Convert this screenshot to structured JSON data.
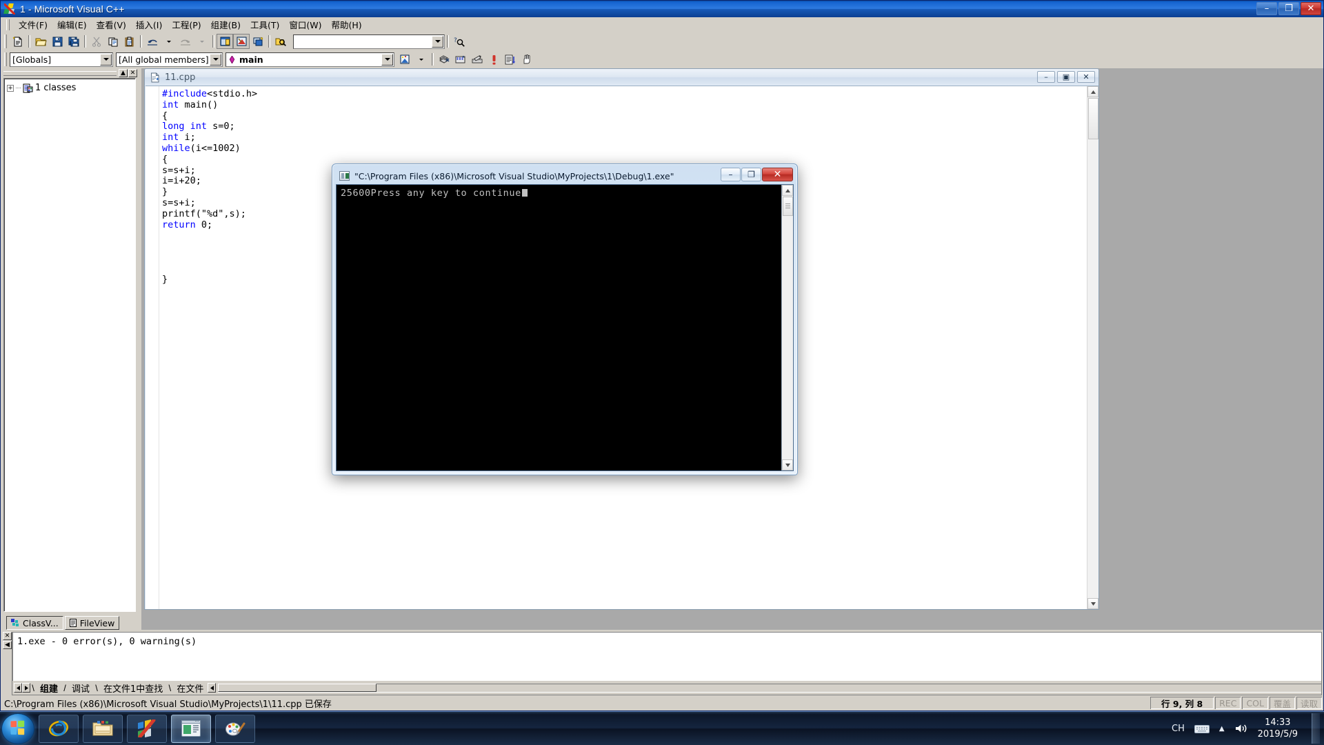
{
  "window": {
    "title": "1 - Microsoft Visual C++",
    "icon": "vc-logo-icon",
    "minimize": "–",
    "maximize": "❐",
    "close": "✕"
  },
  "menu": {
    "items": [
      {
        "label": "文件(F)",
        "name": "menu-file"
      },
      {
        "label": "编辑(E)",
        "name": "menu-edit"
      },
      {
        "label": "查看(V)",
        "name": "menu-view"
      },
      {
        "label": "插入(I)",
        "name": "menu-insert"
      },
      {
        "label": "工程(P)",
        "name": "menu-project"
      },
      {
        "label": "组建(B)",
        "name": "menu-build"
      },
      {
        "label": "工具(T)",
        "name": "menu-tools"
      },
      {
        "label": "窗口(W)",
        "name": "menu-window"
      },
      {
        "label": "帮助(H)",
        "name": "menu-help"
      }
    ]
  },
  "toolbar": {
    "search_box_value": "",
    "buttons": [
      "new-text-file-icon",
      "open-folder-icon",
      "save-icon",
      "save-all-icon",
      "cut-icon",
      "copy-icon",
      "paste-icon",
      "undo-icon",
      "redo-icon",
      "workspace-icon",
      "output-icon",
      "window-list-icon",
      "find-in-files-icon",
      "find-help-icon"
    ]
  },
  "wizardbar": {
    "scope_value": "[Globals]",
    "members_value": "[All global members]",
    "function_value": "main",
    "buttons": [
      "compile-icon",
      "build-icon",
      "rebuild-all-icon",
      "stop-build-icon",
      "batch-build-icon",
      "execute-program-icon"
    ]
  },
  "workspace": {
    "tree_root_label": "1 classes",
    "tree_root_icon": "classes-folder-icon",
    "expander": "+",
    "tabs": [
      {
        "label": "ClassV...",
        "name": "workspace-tab-classview",
        "icon": "classview-icon",
        "selected": true
      },
      {
        "label": "FileView",
        "name": "workspace-tab-fileview",
        "icon": "fileview-icon",
        "selected": false
      }
    ],
    "close_glyph": "✕",
    "collapse_glyph": "▲"
  },
  "editor": {
    "document_name": "11.cpp",
    "document_icon": "source-file-icon",
    "minimize": "–",
    "maximize": "▣",
    "close": "✕",
    "code_lines": [
      {
        "text": "#include<stdio.h>",
        "kw": "#include"
      },
      {
        "text": "int main()",
        "kw": "int"
      },
      {
        "text": "{",
        "kw": ""
      },
      {
        "text": "long int s=0;",
        "kw": "long int"
      },
      {
        "text": "int i;",
        "kw": "int"
      },
      {
        "text": "while(i<=1002)",
        "kw": "while"
      },
      {
        "text": "{",
        "kw": ""
      },
      {
        "text": "s=s+i;",
        "kw": ""
      },
      {
        "text": "i=i+20;",
        "kw": ""
      },
      {
        "text": "}",
        "kw": ""
      },
      {
        "text": "s=s+i;",
        "kw": ""
      },
      {
        "text": "printf(\"%d\",s);",
        "kw": ""
      },
      {
        "text": "return 0;",
        "kw": "return"
      },
      {
        "text": "",
        "kw": ""
      },
      {
        "text": "",
        "kw": ""
      },
      {
        "text": "",
        "kw": ""
      },
      {
        "text": "",
        "kw": ""
      },
      {
        "text": "}",
        "kw": ""
      }
    ]
  },
  "output": {
    "text": "1.exe - 0 error(s), 0 warning(s)",
    "tabs": [
      {
        "label": "组建",
        "name": "output-tab-build",
        "selected": true
      },
      {
        "label": "调试",
        "name": "output-tab-debug",
        "selected": false
      },
      {
        "label": "在文件1中查找",
        "name": "output-tab-find-in-files-1",
        "selected": false
      },
      {
        "label": "在文件",
        "name": "output-tab-find-in-files-2",
        "selected": false
      }
    ],
    "nav_prev": "◀",
    "nav_next": "▶",
    "close_glyph": "✕",
    "collapse_glyph": "◀"
  },
  "status": {
    "message": "C:\\Program Files (x86)\\Microsoft Visual Studio\\MyProjects\\1\\11.cpp 已保存",
    "caret": "行 9, 列 8",
    "indicators": [
      "REC",
      "COL",
      "覆盖",
      "读取"
    ]
  },
  "console": {
    "title": "\"C:\\Program Files (x86)\\Microsoft Visual Studio\\MyProjects\\1\\Debug\\1.exe\"",
    "icon": "console-window-icon",
    "output": "25600Press any key to continue",
    "minimize": "–",
    "maximize": "❐",
    "close": "✕",
    "scroll_up": "▲",
    "scroll_down": "▼"
  },
  "taskbar": {
    "start_label": "start-orb",
    "items": [
      {
        "name": "taskbar-item-internet-explorer",
        "icon": "internet-explorer-icon",
        "active": false
      },
      {
        "name": "taskbar-item-explorer",
        "icon": "folder-explorer-icon",
        "active": false
      },
      {
        "name": "taskbar-item-visual-cpp",
        "icon": "visual-cpp-icon",
        "active": false
      },
      {
        "name": "taskbar-item-console",
        "icon": "console-window-icon",
        "active": true
      },
      {
        "name": "taskbar-item-paint",
        "icon": "paint-icon",
        "active": false
      }
    ],
    "tray": {
      "input_method": "CH",
      "keyboard_icon": "keyboard-icon",
      "show_hidden": "▲",
      "volume_icon": "volume-icon",
      "time": "14:33",
      "date": "2019/5/9"
    }
  },
  "colors": {
    "titlebar_blue": "#1463cf",
    "keyword_blue": "#0000ff",
    "chrome_gray": "#d4d0c8",
    "mdi_gray": "#a9a9a9",
    "console_black": "#000000",
    "close_red": "#cd3a33"
  }
}
